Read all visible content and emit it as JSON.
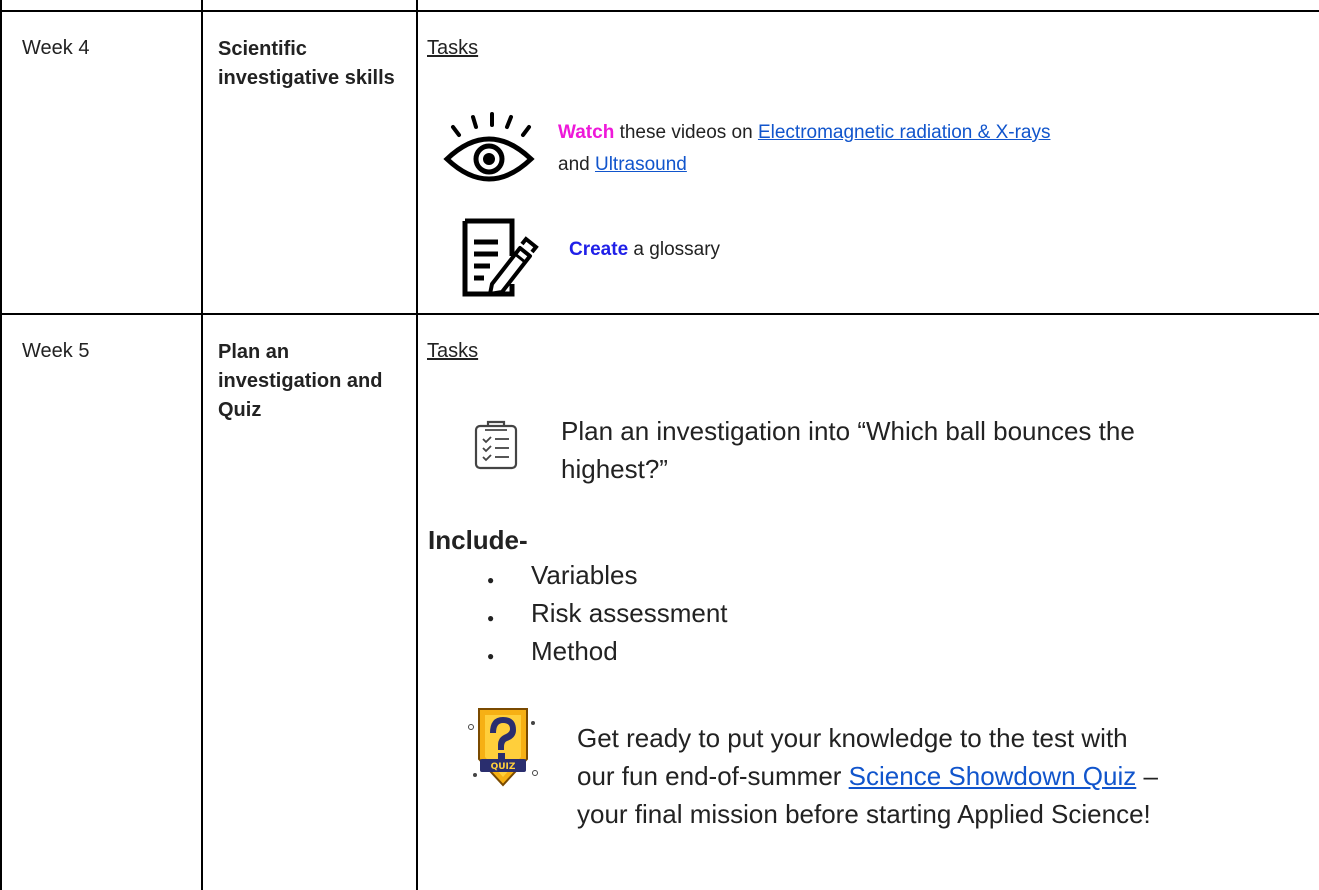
{
  "rows": [
    {
      "week": "Week 4",
      "topic": "Scientific investigative skills",
      "tasks_heading": "Tasks",
      "watch": {
        "verb": "Watch",
        "text_before": " these videos on ",
        "link1": "Electromagnetic radiation & X-rays",
        "and": "and ",
        "link2": "Ultrasound"
      },
      "create": {
        "verb": "Create",
        "text": " a glossary"
      }
    },
    {
      "week": "Week 5",
      "topic": "Plan an investigation and Quiz",
      "tasks_heading": "Tasks",
      "plan_line1": "Plan an investigation into",
      "plan_line1_quote": " “Which ball bounces the",
      "plan_line2": "highest?”",
      "include_label": "Include-",
      "include_items": [
        "Variables",
        "Risk assessment",
        "Method"
      ],
      "quiz_line1": "Get ready to put your knowledge to the test with",
      "quiz_line2_before": "our fun end-of-summer ",
      "quiz_link": "Science Showdown Quiz",
      "quiz_line2_after": " –",
      "quiz_line3": "your final mission before starting Applied Science!",
      "quiz_badge_text": "QUIZ"
    }
  ],
  "colors": {
    "watch": "#ee18d9",
    "create": "#2020e8",
    "link": "#1155cc",
    "border": "#000000"
  },
  "icons": [
    "eye-icon",
    "document-pen-icon",
    "checklist-icon",
    "quiz-badge-icon"
  ]
}
